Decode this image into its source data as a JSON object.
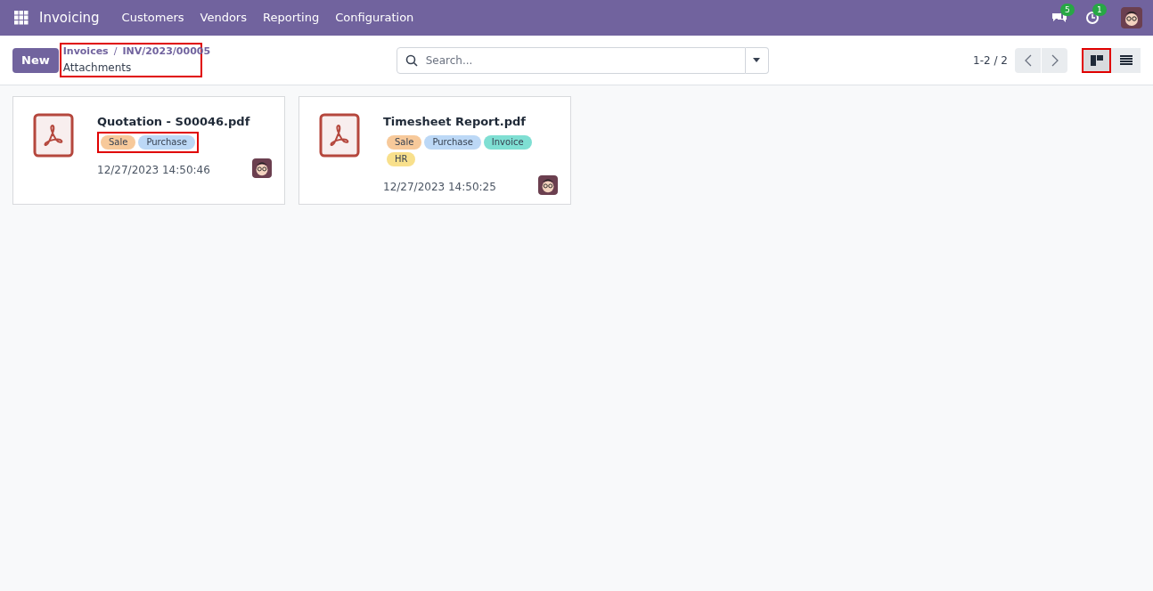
{
  "navbar": {
    "app_name": "Invoicing",
    "menu": [
      "Customers",
      "Vendors",
      "Reporting",
      "Configuration"
    ],
    "messages_badge": "5",
    "activities_badge": "1"
  },
  "control_panel": {
    "new_button": "New",
    "breadcrumbs": [
      "Invoices",
      "INV/2023/00005"
    ],
    "breadcrumb_separator": "/",
    "title": "Attachments",
    "breadcrumb_highlighted": true,
    "search": {
      "placeholder": "Search..."
    },
    "pager": "1-2 / 2",
    "views": [
      {
        "kind": "kanban",
        "selected": true,
        "highlighted": true
      },
      {
        "kind": "list",
        "selected": false,
        "highlighted": false
      }
    ]
  },
  "cards": [
    {
      "name": "Quotation - S00046.pdf",
      "tags_highlighted": true,
      "tags": [
        {
          "label": "Sale",
          "color": "#f7c99a"
        },
        {
          "label": "Purchase",
          "color": "#bcd8f6"
        }
      ],
      "date": "12/27/2023 14:50:46"
    },
    {
      "name": "Timesheet Report.pdf",
      "tags_highlighted": false,
      "tags": [
        {
          "label": "Sale",
          "color": "#f7c99a"
        },
        {
          "label": "Purchase",
          "color": "#bcd8f6"
        },
        {
          "label": "Invoice",
          "color": "#7fdfd3"
        },
        {
          "label": "HR",
          "color": "#f8e08c"
        }
      ],
      "date": "12/27/2023 14:50:25"
    }
  ]
}
